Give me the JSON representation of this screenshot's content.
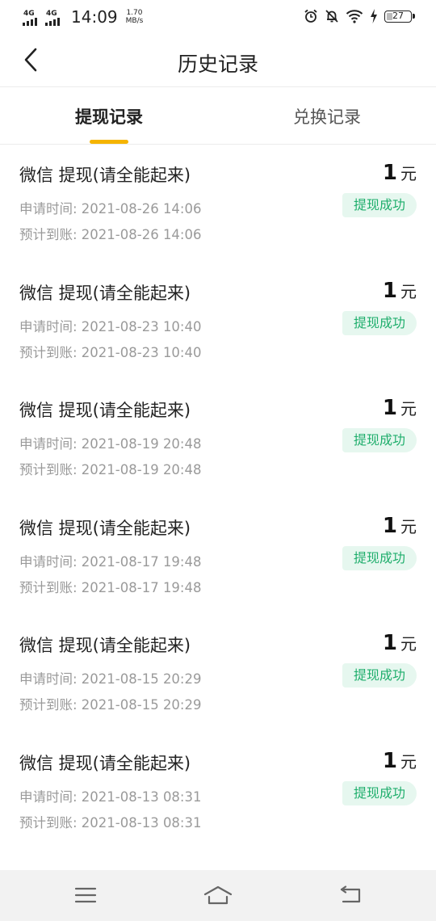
{
  "status_bar": {
    "net1": "4G",
    "net2": "4G",
    "time": "14:09",
    "speed_value": "1.70",
    "speed_unit": "MB/s",
    "battery": "27",
    "icons": [
      "alarm-icon",
      "bell-off-icon",
      "wifi-icon",
      "charging-icon",
      "battery-icon"
    ]
  },
  "header": {
    "title": "历史记录",
    "back_icon": "chevron-left-icon"
  },
  "tabs": [
    {
      "label": "提现记录",
      "active": true
    },
    {
      "label": "兑换记录",
      "active": false
    }
  ],
  "records": [
    {
      "title": "微信 提现(请全能起来)",
      "amount": "1",
      "unit": "元",
      "apply_time": "申请时间: 2021-08-26 14:06",
      "arrival_time": "预计到账: 2021-08-26 14:06",
      "status": "提现成功"
    },
    {
      "title": "微信 提现(请全能起来)",
      "amount": "1",
      "unit": "元",
      "apply_time": "申请时间: 2021-08-23 10:40",
      "arrival_time": "预计到账: 2021-08-23 10:40",
      "status": "提现成功"
    },
    {
      "title": "微信 提现(请全能起来)",
      "amount": "1",
      "unit": "元",
      "apply_time": "申请时间: 2021-08-19 20:48",
      "arrival_time": "预计到账: 2021-08-19 20:48",
      "status": "提现成功"
    },
    {
      "title": "微信 提现(请全能起来)",
      "amount": "1",
      "unit": "元",
      "apply_time": "申请时间: 2021-08-17 19:48",
      "arrival_time": "预计到账: 2021-08-17 19:48",
      "status": "提现成功"
    },
    {
      "title": "微信 提现(请全能起来)",
      "amount": "1",
      "unit": "元",
      "apply_time": "申请时间: 2021-08-15 20:29",
      "arrival_time": "预计到账: 2021-08-15 20:29",
      "status": "提现成功"
    },
    {
      "title": "微信 提现(请全能起来)",
      "amount": "1",
      "unit": "元",
      "apply_time": "申请时间: 2021-08-13 08:31",
      "arrival_time": "预计到账: 2021-08-13 08:31",
      "status": "提现成功"
    }
  ],
  "nav_bar": {
    "icons": [
      "menu-icon",
      "home-icon",
      "back-icon"
    ]
  },
  "colors": {
    "accent": "#f5b400",
    "success_text": "#1fae6c",
    "success_bg": "#e6f7ef"
  }
}
